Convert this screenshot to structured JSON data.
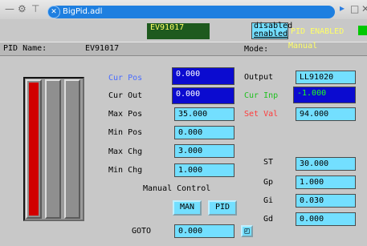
{
  "window": {
    "tab_label": "BigPid.adl"
  },
  "header": {
    "name_label": "PID Name:",
    "name_value": "EV91017",
    "mode_label": "Mode:",
    "mode_value": "Manual",
    "green_box_text": "EV91017",
    "disabled_label": "disabled",
    "enabled_label": "enabled",
    "pid_enabled_text": "PID ENABLED"
  },
  "left": {
    "cur_pos_label": "Cur Pos",
    "cur_pos_value": "0.000",
    "cur_out_label": "Cur Out",
    "cur_out_value": "0.000",
    "max_pos_label": "Max Pos",
    "max_pos_value": "35.000",
    "min_pos_label": "Min Pos",
    "min_pos_value": "0.000",
    "max_chg_label": "Max Chg",
    "max_chg_value": "3.000",
    "min_chg_label": "Min Chg",
    "min_chg_value": "1.000",
    "manual_control_label": "Manual Control",
    "man_button": "MAN",
    "pid_button": "PID",
    "goto_label": "GOTO",
    "goto_value": "0.000",
    "goto_button": "◰"
  },
  "right": {
    "output_label": "Output",
    "output_value": "LL91020",
    "cur_inp_label": "Cur Inp",
    "cur_inp_value": "-1.000",
    "set_val_label": "Set Val",
    "set_val_value": "94.000",
    "st_label": "ST",
    "st_value": "30.000",
    "gp_label": "Gp",
    "gp_value": "1.000",
    "gi_label": "Gi",
    "gi_value": "0.030",
    "gd_label": "Gd",
    "gd_value": "0.000"
  },
  "bars": {
    "levels": [
      1.0,
      0.0,
      0.0
    ]
  },
  "colors": {
    "panel": "#c8c8c8",
    "field": "#73dfff",
    "field_dark": "#0b0bd0",
    "green_box": "#1e5a1e",
    "accent_yellow": "#ffff66",
    "label_blue": "#4a6cff",
    "label_green": "#20c020",
    "label_red": "#ff3b3b",
    "bar_fill": "#d10000",
    "indicator_green": "#00c800"
  }
}
